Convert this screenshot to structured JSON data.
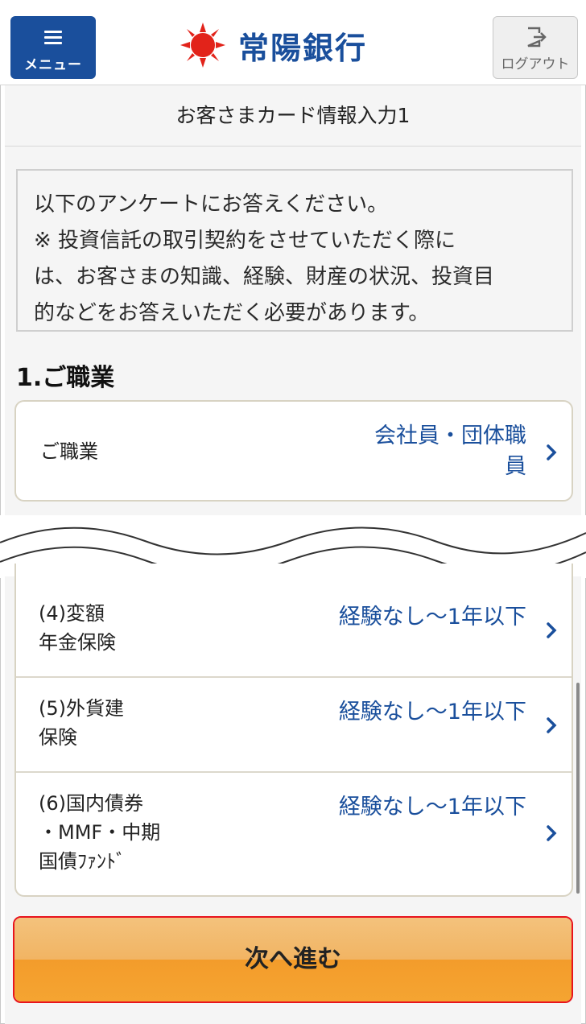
{
  "header": {
    "menu_label": "メニュー",
    "bank_name": "常陽銀行",
    "logout_label": "ログアウト",
    "brand_color": "#1a4f9c",
    "logo_color": "#e2231a"
  },
  "page_title": "お客さまカード情報入力1",
  "notice": {
    "line1": "以下のアンケートにお答えください。",
    "line2": "※ 投資信託の取引契約をさせていただく際に",
    "line3": "は、お客さまの知識、経験、財産の状況、投資目",
    "line4": "的などをお答えいただく必要があります。"
  },
  "section1": {
    "title": "1.ご職業",
    "row_label": "ご職業",
    "value_line1": "会社員・団体職",
    "value_line2": "員"
  },
  "experience_rows": [
    {
      "label_line1": "(4)変額",
      "label_line2": "年金保険",
      "label_line3": "",
      "value": "経験なし～1年以下"
    },
    {
      "label_line1": "(5)外貨建",
      "label_line2": "保険",
      "label_line3": "",
      "value": "経験なし～1年以下"
    },
    {
      "label_line1": "(6)国内債券",
      "label_line2": "・MMF・中期",
      "label_line3": "国債ﾌｧﾝﾄﾞ",
      "value": "経験なし～1年以下"
    }
  ],
  "next_button": {
    "label": "次へ進む",
    "highlight_color": "#e8141e"
  }
}
